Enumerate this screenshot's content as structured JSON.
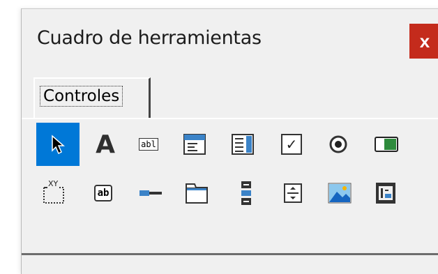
{
  "window": {
    "title": "Cuadro de herramientas",
    "close_label": "x"
  },
  "tabs": [
    {
      "label": "Controles",
      "active": true
    }
  ],
  "tools": [
    {
      "name": "pointer-icon",
      "selected": true
    },
    {
      "name": "label-icon",
      "glyph": "A"
    },
    {
      "name": "textbox-icon",
      "glyph": "abl"
    },
    {
      "name": "combobox-icon"
    },
    {
      "name": "listbox-icon"
    },
    {
      "name": "checkbox-icon",
      "glyph": "✓"
    },
    {
      "name": "optionbutton-icon"
    },
    {
      "name": "togglebutton-icon"
    },
    {
      "name": "frame-icon",
      "glyph": "XY"
    },
    {
      "name": "commandbutton-icon",
      "glyph": "ab"
    },
    {
      "name": "tabstrip-icon"
    },
    {
      "name": "multipage-icon"
    },
    {
      "name": "scrollbar-icon"
    },
    {
      "name": "spinbutton-icon"
    },
    {
      "name": "image-icon"
    },
    {
      "name": "refedit-icon"
    }
  ],
  "colors": {
    "accent": "#0078d7",
    "close": "#c42b1c"
  }
}
